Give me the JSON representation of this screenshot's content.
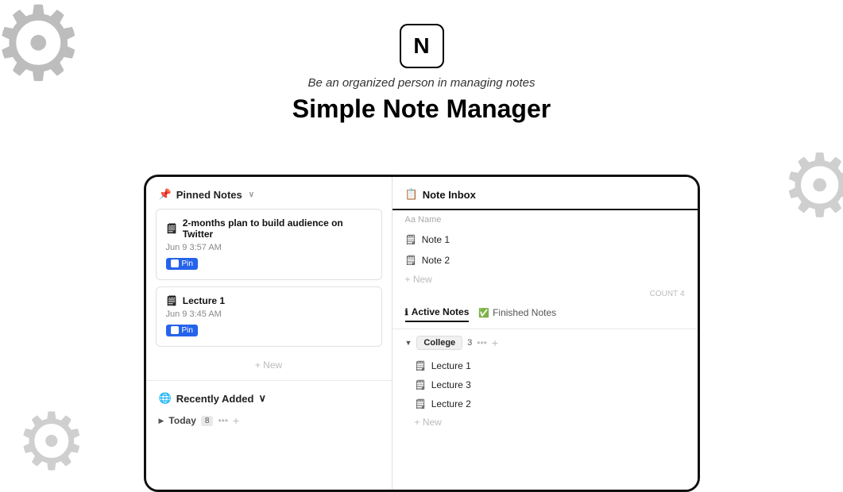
{
  "background": {
    "gear_top_left": "⚙",
    "gear_right": "⚙",
    "gear_bottom_left": "⚙"
  },
  "header": {
    "logo_text": "N",
    "tagline": "Be an organized person in managing notes",
    "title": "Simple Note Manager"
  },
  "left_panel": {
    "pinned_section": {
      "label": "Pinned Notes",
      "chevron": "∨",
      "pin_icon": "📌"
    },
    "note_cards": [
      {
        "icon": "🗒",
        "title": "2-months plan to build audience on Twitter",
        "timestamp": "Jun 9 3:57 AM",
        "pin_label": "Pin"
      },
      {
        "icon": "🗒",
        "title": "Lecture 1",
        "timestamp": "Jun 9 3:45 AM",
        "pin_label": "Pin"
      }
    ],
    "new_button": "+ New",
    "recently_section": {
      "label": "Recently Added",
      "chevron": "∨",
      "earth_icon": "🌐"
    },
    "today_row": {
      "triangle": "▶",
      "label": "Today",
      "count": "8",
      "dots": "•••",
      "plus": "+"
    }
  },
  "right_panel": {
    "note_inbox": {
      "icon": "📋",
      "title": "Note Inbox",
      "name_placeholder": "Aa Name",
      "notes": [
        "Note 1",
        "Note 2"
      ],
      "new_button": "+ New",
      "count_label": "COUNT",
      "count_value": "4"
    },
    "tabs": [
      {
        "label": "Active Notes",
        "active": true,
        "icon": "ℹ"
      },
      {
        "label": "Finished Notes",
        "active": false,
        "icon": "✅"
      }
    ],
    "college_group": {
      "triangle": "▼",
      "label": "College",
      "count": "3",
      "dots": "•••",
      "plus": "+"
    },
    "college_notes": [
      "Lecture 1",
      "Lecture 3",
      "Lecture 2"
    ],
    "note_icon": "🗒",
    "new_button": "+ New"
  }
}
